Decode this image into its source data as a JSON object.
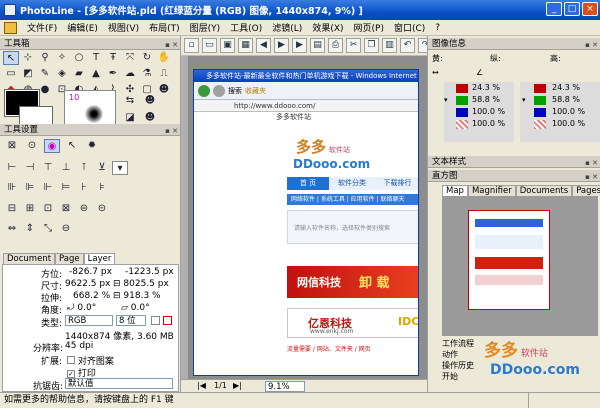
{
  "window": {
    "title": "PhotoLine - [多多软件站.pld  (红绿蓝分量 (RGB) 图像, 1440x874, 9%) ]",
    "min_btn": "_",
    "max_btn": "□",
    "close_btn": "×"
  },
  "menubar": {
    "items": [
      "文件(F)",
      "编辑(E)",
      "视图(V)",
      "布局(T)",
      "图层(Y)",
      "工具(O)",
      "滤镜(L)",
      "效果(X)",
      "网页(P)",
      "窗口(C)",
      "?"
    ]
  },
  "left": {
    "toolbox_title": "工具箱",
    "color_index": "10",
    "tool_settings_title": "工具设置",
    "layer_tabs": [
      "Document",
      "Page",
      "Layer"
    ],
    "layer_props": {
      "pos_label": "方位:",
      "pos_x": "-826.7 px",
      "pos_y": "-1223.5 px",
      "size_label": "尺寸:",
      "size_w": "9622.5 px",
      "size_h": "8025.5 px",
      "scale_label": "拉伸:",
      "scale_x": "668.2 %",
      "scale_y": "918.3 %",
      "angle_label": "角度:",
      "angle_a": "0.0°",
      "angle_b": "0.0°",
      "type_label": "类型:",
      "type_mode": "RGB",
      "type_bits": "8 位",
      "pixels_info": "1440x874 像素, 3.60 MB",
      "res_label": "分辨率:",
      "res_value": "45 dpi",
      "ext_label": "扩展:",
      "align_label": "对齐图案",
      "print_label": "打印",
      "aa_label": "抗锯齿:",
      "aa_value": "默认值"
    }
  },
  "canvas": {
    "page_nav": "1/1",
    "zoom": "9.1%",
    "web": {
      "window_title": "多多软件站-最新最全软件和热门单机游戏下载 - Windows Internet Explorer",
      "address": "http://www.ddooo.com/",
      "tab_label": "多多软件站",
      "search_btn": "搜索",
      "fav_btn": "收藏夹",
      "nav_first": "首 页",
      "nav_second": "软件分类",
      "nav_third": "下载排行",
      "sub_links": "网络软件 | 系统工具 | 应用软件 | 联络聊天",
      "search_hint": "请输入软件名称，选择软件类别搜索",
      "logo_text": "多多",
      "logo_sub": "软件站",
      "logo_domain": "DDooo.com",
      "ad1": "网信科技",
      "ad1b": "卸 载",
      "ad2": "亿恩科技",
      "ad2b": "IDC",
      "ad2_url": "www.enkj.com",
      "footer_note": "流量需要 / 网站、文件夹 / 网页"
    }
  },
  "right": {
    "image_info_title": "图像信息",
    "col_yellow": "黄:",
    "col_green": "纵:",
    "col_high": "高:",
    "pct_rows": [
      "24.3 %",
      "58.8 %",
      "100.0 %",
      "100.0 %"
    ],
    "pct_rows_right": [
      "24.3 %",
      "58.8 %",
      "100.0 %",
      "100.0 %"
    ],
    "text_styles_title": "文本样式",
    "histogram_title": "直方图",
    "tabs": [
      "Map",
      "Magnifier",
      "Documents",
      "Pages"
    ],
    "bottom_items": [
      "工作流程",
      "动作",
      "操作历史",
      "开始"
    ],
    "watermark_text": "多多",
    "watermark_sub": "软件站",
    "watermark_domain": "DDooo.com"
  },
  "status": {
    "help_text": "如需更多的帮助信息，请按键盘上的 F1 键"
  }
}
